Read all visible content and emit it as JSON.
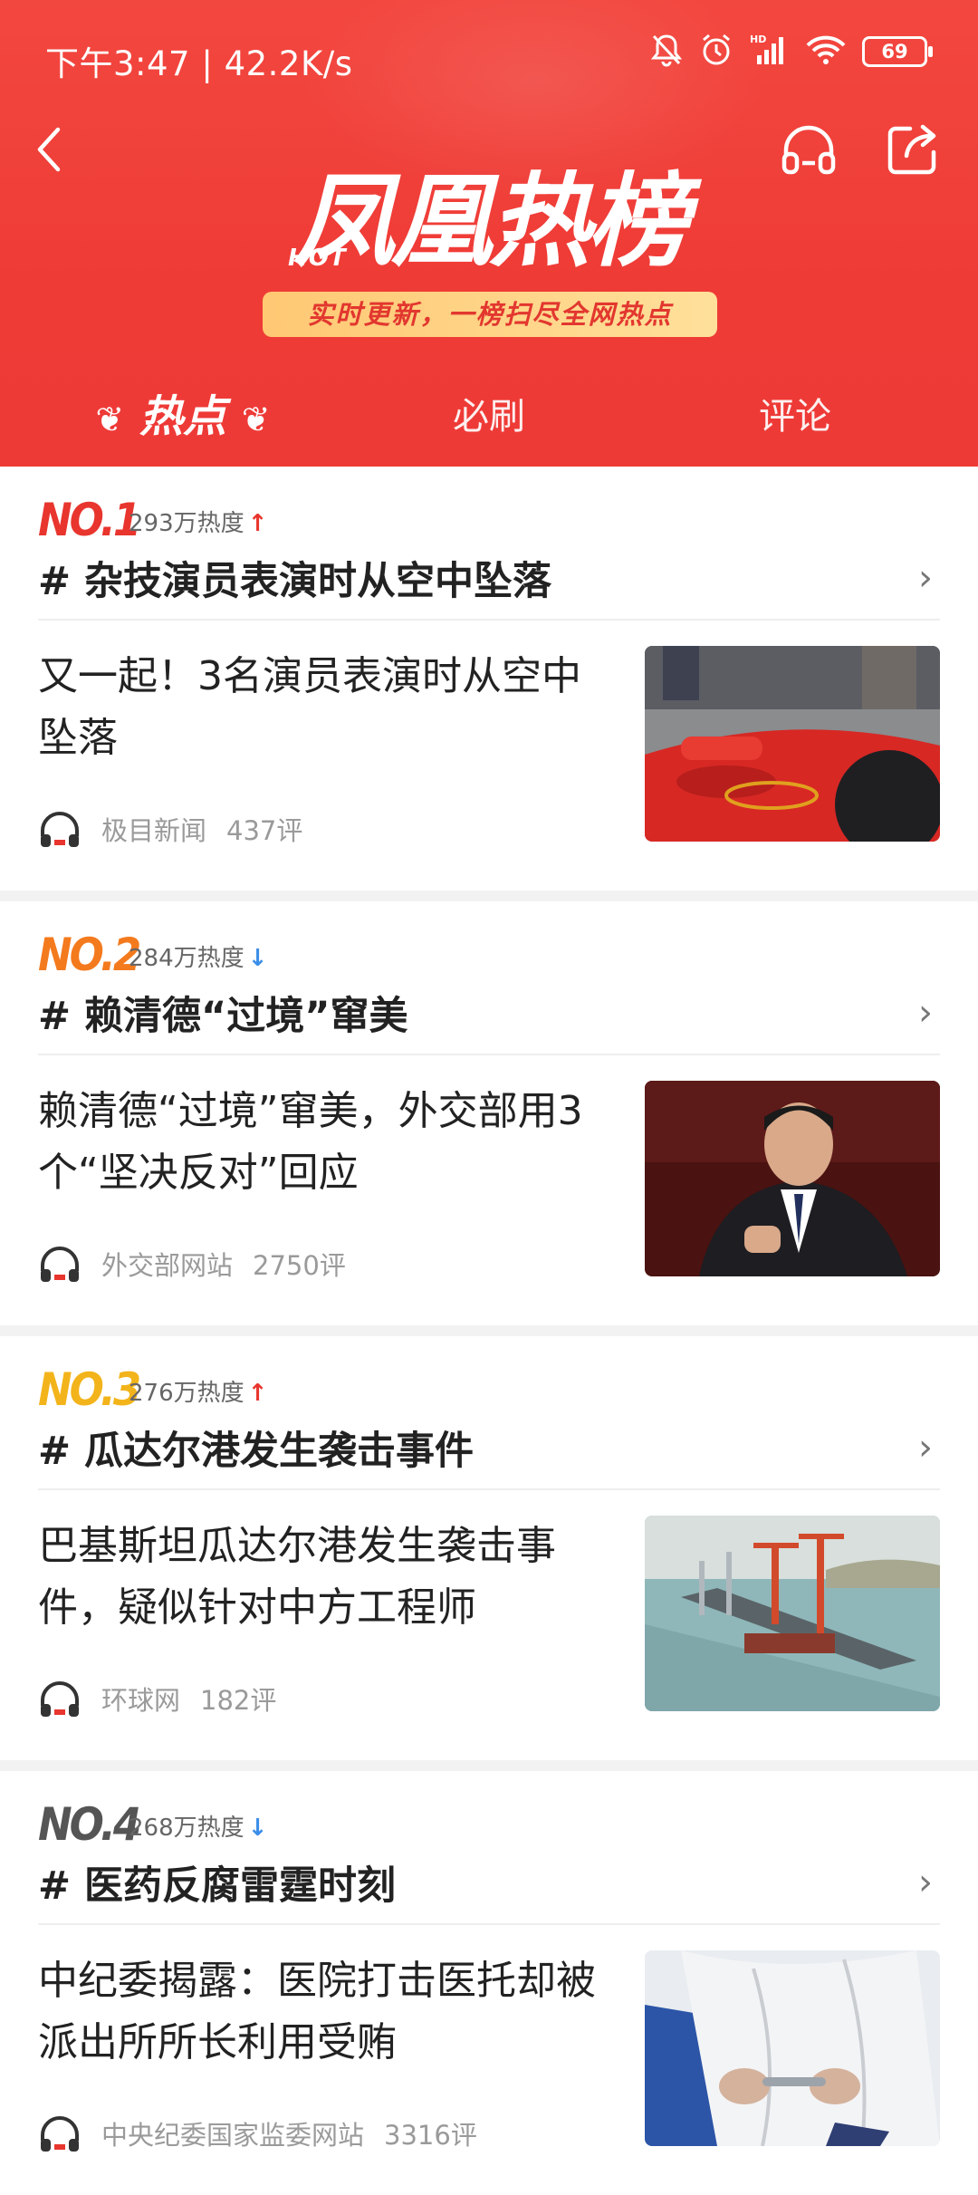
{
  "status_bar": {
    "time": "下午3:47",
    "speed": "42.2K/s",
    "battery": "69",
    "network": "HD"
  },
  "header": {
    "logo_text": "凤凰热榜",
    "logo_hot": "HOT",
    "slogan": "实时更新，一榜扫尽全网热点"
  },
  "tabs": [
    {
      "label": "热点",
      "active": true
    },
    {
      "label": "必刷",
      "active": false
    },
    {
      "label": "评论",
      "active": false
    }
  ],
  "items": [
    {
      "rank": "NO.1",
      "rank_color": "#e8352e",
      "heat": "293万热度",
      "trend": "up",
      "topic": "# 杂技演员表演时从空中坠落",
      "desc": "又一起！3名演员表演时从空中坠落",
      "source": "极目新闻",
      "comments": "437评"
    },
    {
      "rank": "NO.2",
      "rank_color": "#f47a1e",
      "heat": "284万热度",
      "trend": "down",
      "topic": "# 赖清德“过境”窜美",
      "desc": "赖清德“过境”窜美，外交部用3个“坚决反对”回应",
      "source": "外交部网站",
      "comments": "2750评"
    },
    {
      "rank": "NO.3",
      "rank_color": "#f3b41b",
      "heat": "276万热度",
      "trend": "up",
      "topic": "# 瓜达尔港发生袭击事件",
      "desc": "巴基斯坦瓜达尔港发生袭击事件，疑似针对中方工程师",
      "source": "环球网",
      "comments": "182评"
    },
    {
      "rank": "NO.4",
      "rank_color": "#555555",
      "heat": "268万热度",
      "trend": "down",
      "topic": "# 医药反腐雷霆时刻",
      "desc": "中纪委揭露：医院打击医托却被派出所所长利用受贿",
      "source": "中央纪委国家监委网站",
      "comments": "3316评"
    }
  ],
  "colors": {
    "header_red": "#ee3a37",
    "trend_up": "#e8352e",
    "trend_down": "#3b8ee8"
  }
}
